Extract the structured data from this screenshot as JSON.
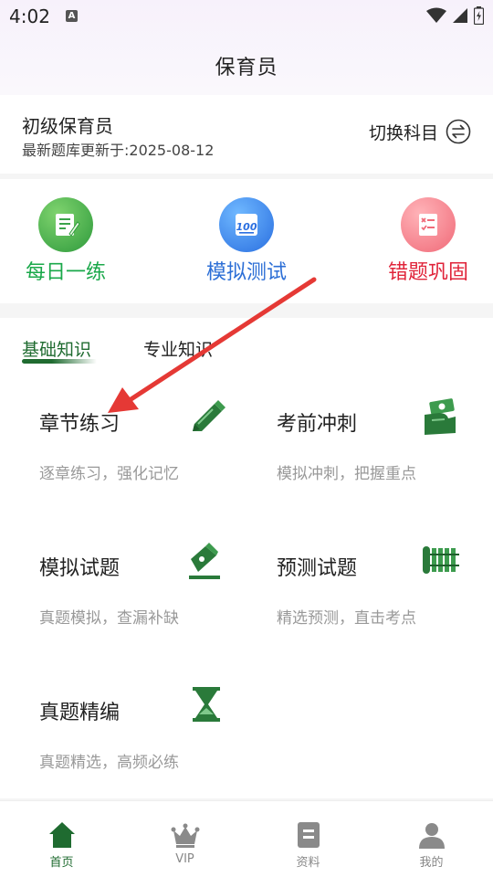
{
  "status_bar": {
    "time": "4:02",
    "notification_letter": "A"
  },
  "header": {
    "title": "保育员"
  },
  "subject": {
    "name": "初级保育员",
    "update_text": "最新题库更新于:2025-08-12",
    "switch_label": "切换科目"
  },
  "quick_actions": [
    {
      "label": "每日一练",
      "color": "#1aa84a",
      "icon": "daily-practice-icon"
    },
    {
      "label": "模拟测试",
      "color": "#2d6fd6",
      "icon": "mock-test-icon"
    },
    {
      "label": "错题巩固",
      "color": "#e0243a",
      "icon": "wrong-questions-icon"
    }
  ],
  "tabs": {
    "basic": "基础知识",
    "professional": "专业知识"
  },
  "grid": [
    {
      "title": "章节练习",
      "desc": "逐章练习，强化记忆",
      "icon": "pencil-icon"
    },
    {
      "title": "考前冲刺",
      "desc": "模拟冲刺，把握重点",
      "icon": "cash-hand-icon"
    },
    {
      "title": "模拟试题",
      "desc": "真题模拟，查漏补缺",
      "icon": "fountain-pen-icon"
    },
    {
      "title": "预测试题",
      "desc": "精选预测，直击考点",
      "icon": "bamboo-scroll-icon"
    },
    {
      "title": "真题精编",
      "desc": "真题精选，高频必练",
      "icon": "hourglass-icon"
    }
  ],
  "bottom_nav": [
    {
      "label": "首页",
      "active": true
    },
    {
      "label": "VIP",
      "active": false
    },
    {
      "label": "资料",
      "active": false
    },
    {
      "label": "我的",
      "active": false
    }
  ],
  "colors": {
    "accent": "#1f6b30",
    "annotation_arrow": "#e53935"
  }
}
